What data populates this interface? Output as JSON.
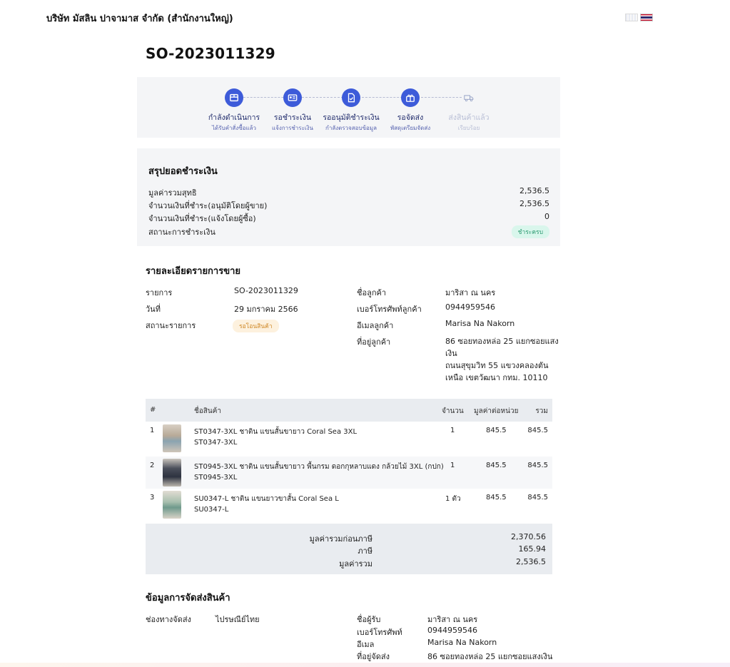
{
  "header": {
    "company": "บริษัท มัสลิน ปาจามาส จำกัด (สำนักงานใหญ่)"
  },
  "order": {
    "number": "SO-2023011329"
  },
  "steps": [
    {
      "title": "กำลังดำเนินการ",
      "sub": "ได้รับคำสั่งซื้อแล้ว",
      "icon": "box-icon",
      "active": true
    },
    {
      "title": "รอชำระเงิน",
      "sub": "แจ้งการชำระเงิน",
      "icon": "card-icon",
      "active": true
    },
    {
      "title": "รออนุมัติชำระเงิน",
      "sub": "กำลังตรวจสอบข้อมูล",
      "icon": "document-check-icon",
      "active": true
    },
    {
      "title": "รอจัดส่ง",
      "sub": "พัสดุเตรียมจัดส่ง",
      "icon": "gift-box-icon",
      "active": true
    },
    {
      "title": "ส่งสินค้าแล้ว",
      "sub": "เรียบร้อย",
      "icon": "truck-icon",
      "active": false
    }
  ],
  "payment": {
    "title": "สรุปยอดชำระเงิน",
    "rows": [
      {
        "label": "มูลค่ารวมสุทธิ",
        "value": "2,536.5"
      },
      {
        "label": "จำนวนเงินที่ชำระ(อนุมัติโดยผู้ขาย)",
        "value": "2,536.5"
      },
      {
        "label": "จำนวนเงินที่ชำระ(แจ้งโดยผู้ซื้อ)",
        "value": "0"
      }
    ],
    "status_label": "สถานะการชำระเงิน",
    "status_badge": "ชำระครบ"
  },
  "sale": {
    "title": "รายละเอียดรายการขาย",
    "left": [
      {
        "label": "รายการ",
        "value": "SO-2023011329"
      },
      {
        "label": "วันที่",
        "value": "29 มกราคม 2566"
      }
    ],
    "status_label": "สถานะรายการ",
    "status_badge": "รอโอนสินค้า",
    "right": [
      {
        "label": "ชื่อลูกค้า",
        "value": "มาริสา ณ นคร"
      },
      {
        "label": "เบอร์โทรศัพท์ลูกค้า",
        "value": "0944959546"
      },
      {
        "label": "อีเมลลูกค้า",
        "value": "Marisa Na Nakorn"
      }
    ],
    "address_label": "ที่อยู่ลูกค้า",
    "address_lines": [
      "86 ซอยทองหล่อ 25 แยกซอยแสง",
      "เงิน",
      "ถนนสุขุมวิท 55 แขวงคลองตัน",
      "เหนือ เขตวัฒนา กทม. 10110"
    ]
  },
  "table": {
    "headers": {
      "index": "#",
      "name": "ชื่อสินค้า",
      "qty": "จำนวน",
      "unit": "มูลค่าต่อหน่วย",
      "total": "รวม"
    },
    "rows": [
      {
        "index": "1",
        "name": "ST0347-3XL ชาติน แขนสั้นขายาว Coral Sea 3XL",
        "sku": "ST0347-3XL",
        "qty": "1",
        "unit": "845.5",
        "total": "845.5"
      },
      {
        "index": "2",
        "name": "ST0945-3XL ชาติน แขนสั้นขายาว พื้นกรม ดอกกุหลาบแดง กล้วยไม้ 3XL (กปก)",
        "sku": "ST0945-3XL",
        "qty": "1",
        "unit": "845.5",
        "total": "845.5"
      },
      {
        "index": "3",
        "name": "SU0347-L ชาติน แขนยาวขาสั้น Coral Sea L",
        "sku": "SU0347-L",
        "qty": "1 ตัว",
        "unit": "845.5",
        "total": "845.5"
      }
    ],
    "totals": [
      {
        "label": "มูลค่ารวมก่อนภาษี",
        "value": "2,370.56"
      },
      {
        "label": "ภาษี",
        "value": "165.94"
      },
      {
        "label": "มูลค่ารวม",
        "value": "2,536.5"
      }
    ]
  },
  "shipping": {
    "title": "ข้อมูลการจัดส่งสินค้า",
    "channel_label": "ช่องทางจัดส่ง",
    "channel_value": "ไปรษณีย์ไทย",
    "rows": [
      {
        "label": "ชื่อผู้รับ",
        "value": "มาริสา ณ นคร"
      },
      {
        "label": "เบอร์โทรศัพท์",
        "value": "0944959546"
      },
      {
        "label": "อีเมล",
        "value": "Marisa Na Nakorn"
      },
      {
        "label": "ที่อยู่จัดส่ง",
        "value": "86 ซอยทองหล่อ 25 แยกซอยแสงเงิน"
      }
    ]
  }
}
